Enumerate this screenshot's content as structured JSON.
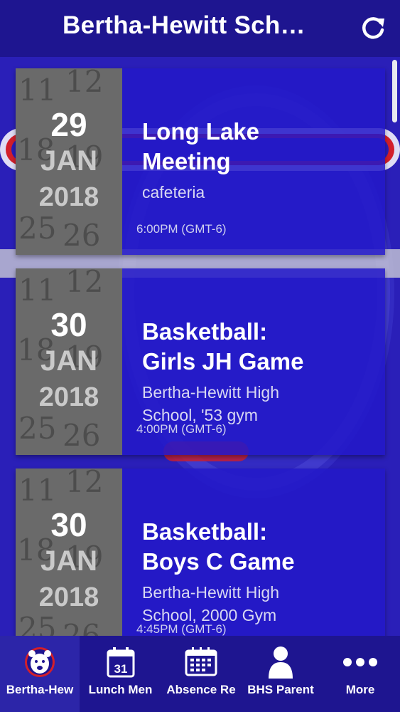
{
  "header": {
    "title": "Bertha-Hewitt Sch…"
  },
  "events": [
    {
      "day": "29",
      "month": "JAN",
      "year": "2018",
      "title_line1": "Long Lake",
      "title_line2": "Meeting",
      "location_line1": "cafeteria",
      "location_line2": "",
      "time": "6:00PM (GMT-6)"
    },
    {
      "day": "30",
      "month": "JAN",
      "year": "2018",
      "title_line1": "Basketball:",
      "title_line2": "Girls JH Game",
      "location_line1": "Bertha-Hewitt High",
      "location_line2": "School, '53 gym",
      "time": "4:00PM (GMT-6)"
    },
    {
      "day": "30",
      "month": "JAN",
      "year": "2018",
      "title_line1": "Basketball:",
      "title_line2": "Boys C Game",
      "location_line1": "Bertha-Hewitt High",
      "location_line2": "School, 2000 Gym",
      "time": "4:45PM (GMT-6)"
    }
  ],
  "tabs": [
    {
      "label": "Bertha-Hew",
      "icon": "bear-logo-icon"
    },
    {
      "label": "Lunch Men",
      "icon": "calendar-icon",
      "icon_text": "31"
    },
    {
      "label": "Absence Re",
      "icon": "calendar-grid-icon"
    },
    {
      "label": "BHS Parent",
      "icon": "person-icon"
    },
    {
      "label": "More",
      "icon": "more-dots-icon"
    }
  ],
  "colors": {
    "background": "#2a1fb8",
    "header": "#1e1590",
    "card": "#2319c8",
    "date_panel": "#6a6a6a"
  }
}
